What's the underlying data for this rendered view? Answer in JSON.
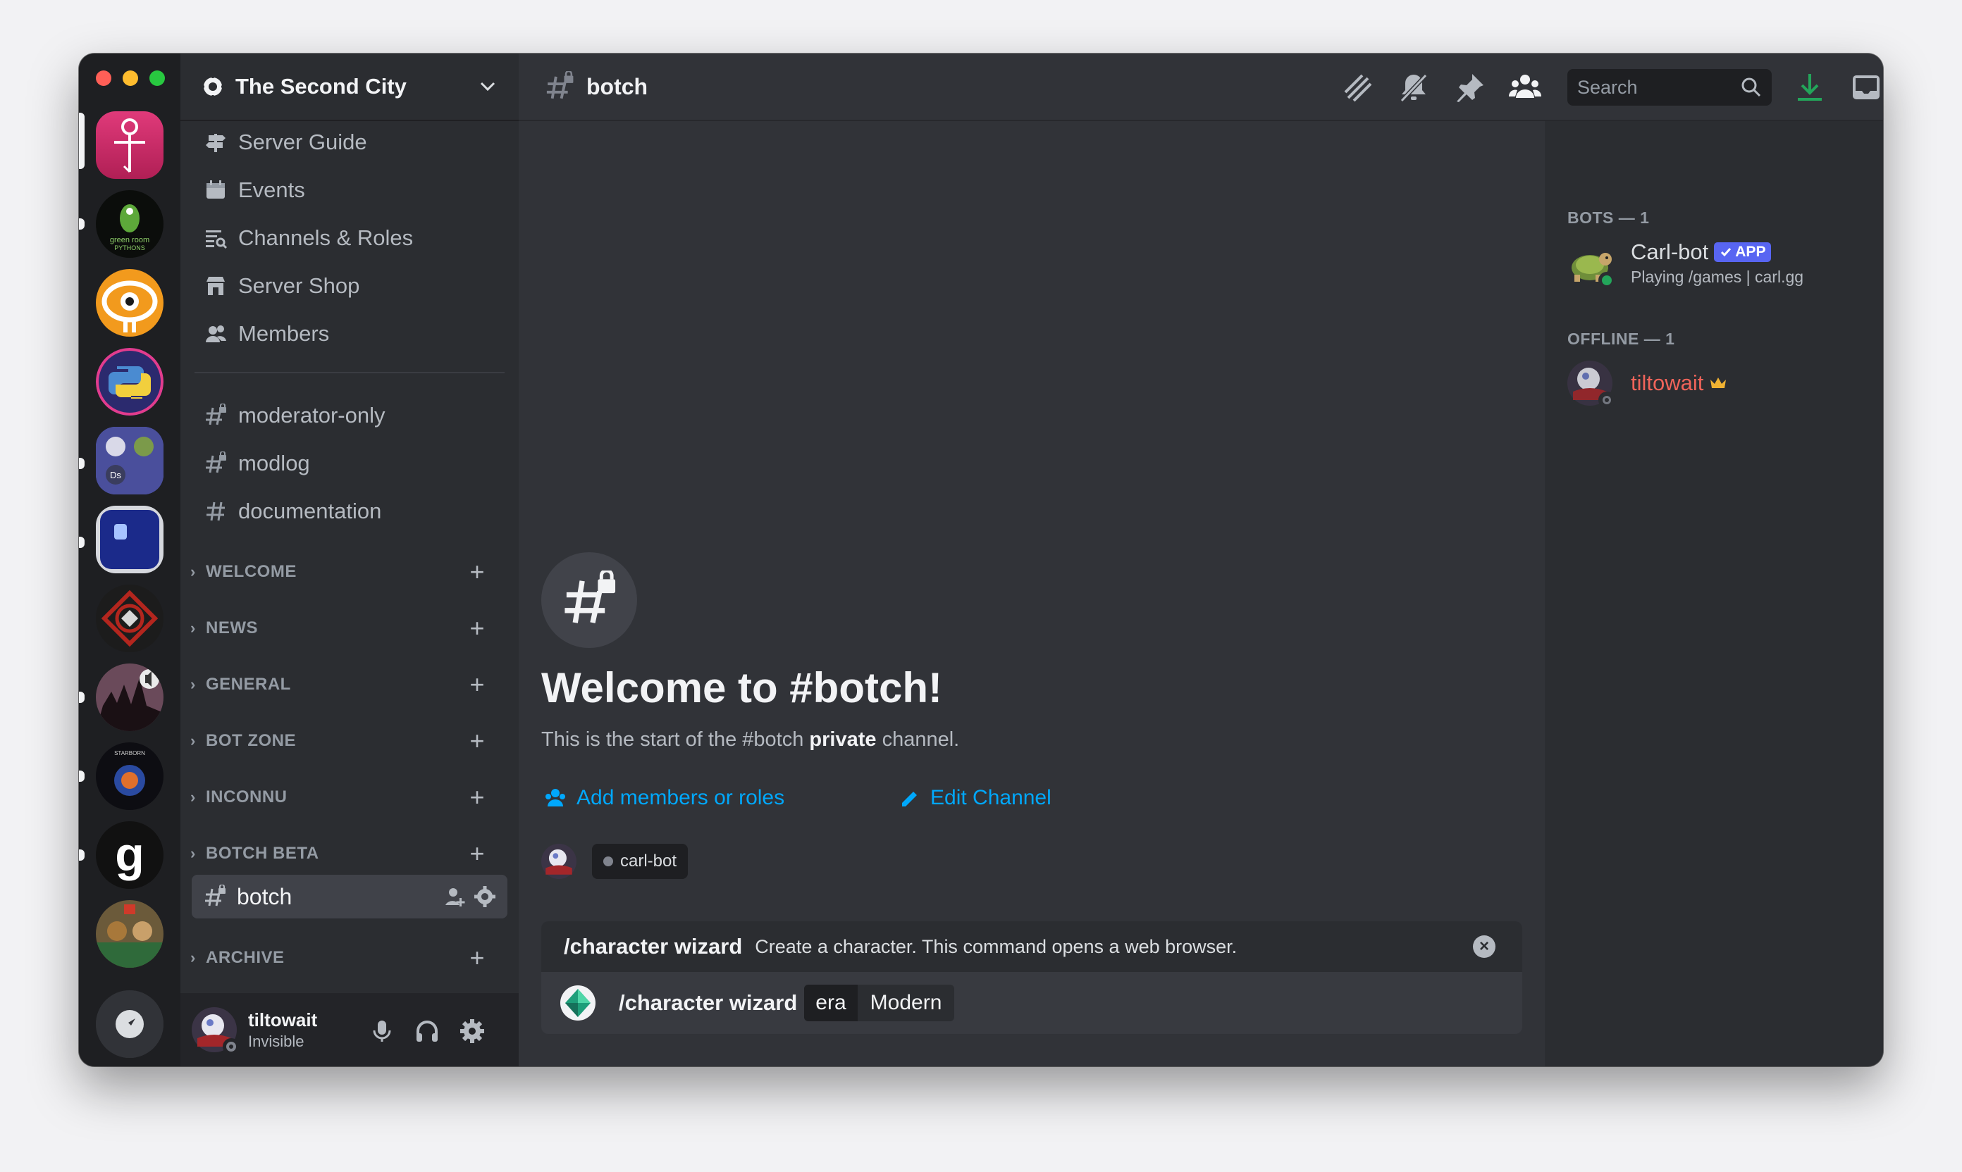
{
  "server": {
    "name": "The Second City"
  },
  "nav": [
    {
      "label": "Server Guide",
      "icon": "signpost-icon"
    },
    {
      "label": "Events",
      "icon": "calendar-icon"
    },
    {
      "label": "Channels & Roles",
      "icon": "channels-roles-icon"
    },
    {
      "label": "Server Shop",
      "icon": "shop-icon"
    },
    {
      "label": "Members",
      "icon": "members-icon"
    }
  ],
  "channels": [
    "moderator-only",
    "modlog",
    "documentation"
  ],
  "categories": [
    "WELCOME",
    "NEWS",
    "GENERAL",
    "BOT ZONE",
    "INCONNU",
    "BOTCH BETA",
    "ARCHIVE"
  ],
  "active_channel": "botch",
  "user": {
    "name": "tiltowait",
    "status": "Invisible"
  },
  "header": {
    "channel": "botch",
    "search_placeholder": "Search"
  },
  "welcome": {
    "title": "Welcome to #botch!",
    "sub_prefix": "This is the start of the #botch ",
    "sub_bold": "private",
    "sub_suffix": " channel.",
    "add_members": "Add members or roles",
    "edit_channel": "Edit Channel",
    "member_chip": "carl-bot"
  },
  "command": {
    "name": "/character wizard",
    "description": "Create a character. This command opens a web browser.",
    "option_key": "era",
    "option_value": "Modern"
  },
  "member_list": {
    "bots_header": "BOTS — 1",
    "offline_header": "OFFLINE — 1",
    "bot": {
      "name": "Carl-bot",
      "badge": "APP",
      "activity": "Playing /games | carl.gg"
    },
    "offline_user": {
      "name": "tiltowait"
    }
  },
  "colors": {
    "accent_link": "#00a8fc",
    "online": "#23a55a",
    "owner_name": "#f0645a",
    "crown": "#f0b232",
    "app_badge": "#5865f2"
  }
}
